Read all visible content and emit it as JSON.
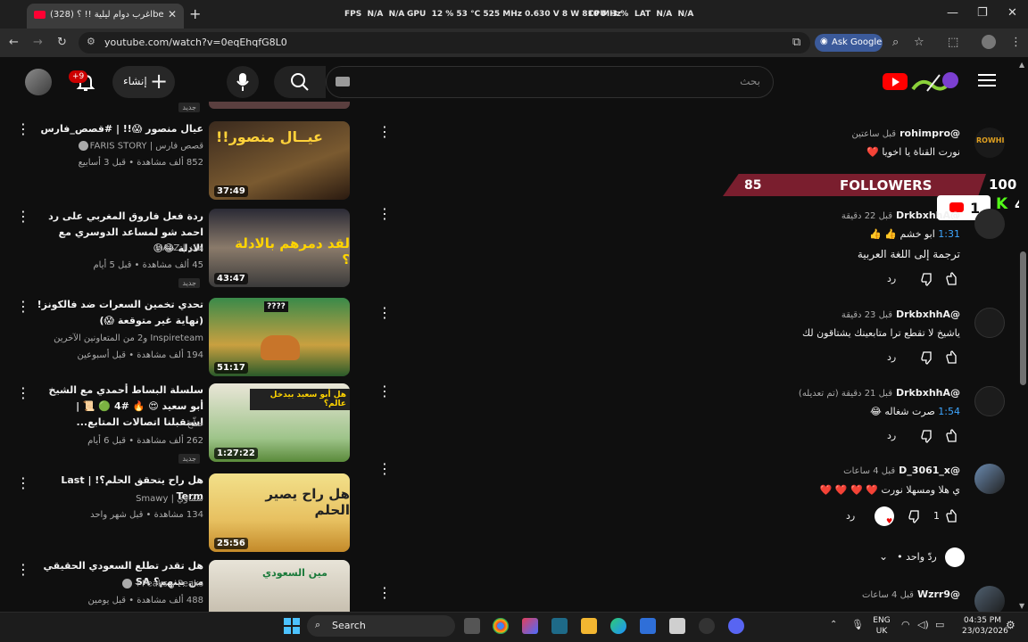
{
  "browser": {
    "tab_title": "(328) اغرب دوام ليلية !! ؟be",
    "url": "youtube.com/watch?v=0eqEhqfG8L0",
    "ask_google": "Ask Google",
    "stats": {
      "fps_label": "FPS",
      "fps1": "N/A",
      "fps2": "N/A",
      "gpu_label": "GPU",
      "gpu_load": "12 %",
      "gpu_temp": "53 °C",
      "gpu_clock": "525 MHz",
      "gpu_volt": "0.630 V",
      "gpu_power": "8 W",
      "gpu_mem": "810 MHz",
      "cpu_label": "CPU",
      "cpu_load": "3 %",
      "lat_label": "LAT",
      "lat1": "N/A",
      "lat2": "N/A"
    }
  },
  "header": {
    "search_placeholder": "بحث",
    "create_label": "إنشاء",
    "notif_badge": "+9"
  },
  "videos": [
    {
      "title": "عيال منصور 😱!! | #قصص_فارس",
      "channel": "قصص فارس | FARIS STORY",
      "meta": "852 ألف مشاهدة • قبل 3 أسابيع",
      "duration": "37:49",
      "new": "",
      "verified": true,
      "thumb_text": "عيــال منصور!!"
    },
    {
      "title": "ردة فعل فاروق المغربي على رد احمد شو لمساعد الدوسري مع الادلة 😂😝",
      "channel": "هالز | HALZ",
      "meta": "45 ألف مشاهدة • قبل 5 أيام",
      "duration": "43:47",
      "new": "جديد",
      "verified": false,
      "thumb_text": "لقد دمرهم بالادلة ؟"
    },
    {
      "title": "تحدي تخمين السعرات ضد فالكونز! (نهاية غير متوقعة 😱)",
      "channel": "Inspireteam و2 من المتعاونين الآخرين",
      "meta": "194 ألف مشاهدة • قبل أسبوعين",
      "duration": "51:17",
      "new": "",
      "verified": false,
      "thumb_text": "????"
    },
    {
      "title": "سلسلة البساط أحمدي مع الشيخ أبو سعيد 😍 🔥 #4 🟢 📜 | استقبلنا اتصالات المتابع...",
      "channel": "صلّح",
      "meta": "262 ألف مشاهدة • قبل 6 أيام",
      "duration": "1:27:22",
      "new": "جديد",
      "verified": false,
      "thumb_text": "هل أبو سعيد بيدخل عالم؟"
    },
    {
      "title": "هل راح يتحقق الحلم؟! | Last Term",
      "channel": "سماوي | Smawy",
      "meta": "134 مشاهدة • قبل شهر واحد",
      "duration": "25:56",
      "new": "",
      "verified": false,
      "thumb_text": "هل راح يصير الحلم"
    },
    {
      "title": "هل تقدر تطلع السعودي الحقيقي من بينهم؟ SA",
      "channel": "Peaks و Peaks+",
      "meta": "488 ألف مشاهدة • قبل يومين",
      "duration": "",
      "new": "",
      "verified": true,
      "thumb_text": "مين السعودي"
    }
  ],
  "comments": [
    {
      "author": "@rohimpro",
      "time": "قبل ساعتين",
      "text": "نورت القناة يا اخويا ❤️"
    },
    {
      "author": "@DrkbxhhA",
      "time": "قبل 22 دقيقة",
      "ts": "1:31",
      "text": "ابو خشم 👍 👍",
      "translate": "ترجمة إلى اللغة العربية",
      "reply": "رد"
    },
    {
      "author": "@DrkbxhhA",
      "time": "قبل 23 دقيقة",
      "text": "ياشيخ لا تقطع ترا متابعينك يشتاقون لك",
      "reply": "رد"
    },
    {
      "author": "@DrkbxhhA",
      "time": "قبل 21 دقيقة (تم تعديله)",
      "ts": "1:54",
      "text": "صرت شغاله 😂",
      "reply": "رد"
    },
    {
      "author": "@D_3061_x",
      "time": "قبل 4 ساعات",
      "text": "ي هلا ومسهلا نورت ❤️ ❤️ ❤️ ❤️",
      "likes": "1",
      "reply": "رد",
      "replies_toggle": "• ردّ واحد"
    },
    {
      "author": "@Wzrr9",
      "time": "قبل 4 ساعات"
    }
  ],
  "overlay": {
    "followers_count": "85",
    "followers_label": "FOLLOWERS",
    "followers_goal": "100",
    "youtube_subs": "1",
    "kick_letter": "K",
    "kick_count": "4"
  },
  "taskbar": {
    "search_label": "Search",
    "lang_1": "ENG",
    "lang_2": "UK",
    "time": "04:35 PM",
    "date": "23/03/2026"
  },
  "colors": {
    "accent_red": "#ff0000",
    "link_blue": "#3ea6ff",
    "kick_green": "#53fc18"
  }
}
